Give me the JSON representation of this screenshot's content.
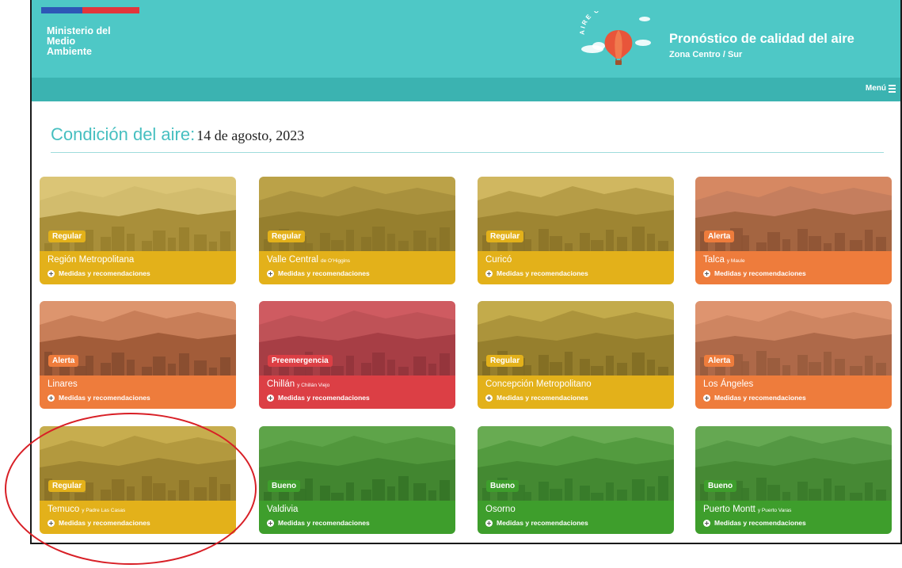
{
  "header": {
    "ministry_lines": [
      "Ministerio del",
      "Medio",
      "Ambiente"
    ],
    "logo_arc_text": "AIRE CHILE",
    "title": "Pronóstico de calidad del aire",
    "subtitle": "Zona Centro / Sur",
    "menu_label": "Menú"
  },
  "heading": {
    "label": "Condición del aire:",
    "date": "14 de agosto, 2023"
  },
  "status_colors": {
    "Regular": "#e3b11a",
    "Alerta": "#ee7c3c",
    "Preemergencia": "#dc3f45",
    "Bueno": "#3e9e2c"
  },
  "brand_colors": {
    "teal": "#4ec8c6",
    "teal_dark": "#3bb3b1"
  },
  "link_label": "Medidas y recomendaciones",
  "cards": [
    {
      "name": "Región Metropolitana",
      "suffix": "",
      "status": "Regular"
    },
    {
      "name": "Valle Central",
      "suffix": "de O'Higgins",
      "status": "Regular"
    },
    {
      "name": "Curicó",
      "suffix": "",
      "status": "Regular"
    },
    {
      "name": "Talca",
      "suffix": "y Maule",
      "status": "Alerta"
    },
    {
      "name": "Linares",
      "suffix": "",
      "status": "Alerta"
    },
    {
      "name": "Chillán",
      "suffix": "y Chillán Viejo",
      "status": "Preemergencia"
    },
    {
      "name": "Concepción Metropolitano",
      "suffix": "",
      "status": "Regular"
    },
    {
      "name": "Los Ángeles",
      "suffix": "",
      "status": "Alerta"
    },
    {
      "name": "Temuco",
      "suffix": "y Padre Las Casas",
      "status": "Regular"
    },
    {
      "name": "Valdivia",
      "suffix": "",
      "status": "Bueno"
    },
    {
      "name": "Osorno",
      "suffix": "",
      "status": "Bueno"
    },
    {
      "name": "Puerto Montt",
      "suffix": "y Puerto Varas",
      "status": "Bueno"
    }
  ]
}
